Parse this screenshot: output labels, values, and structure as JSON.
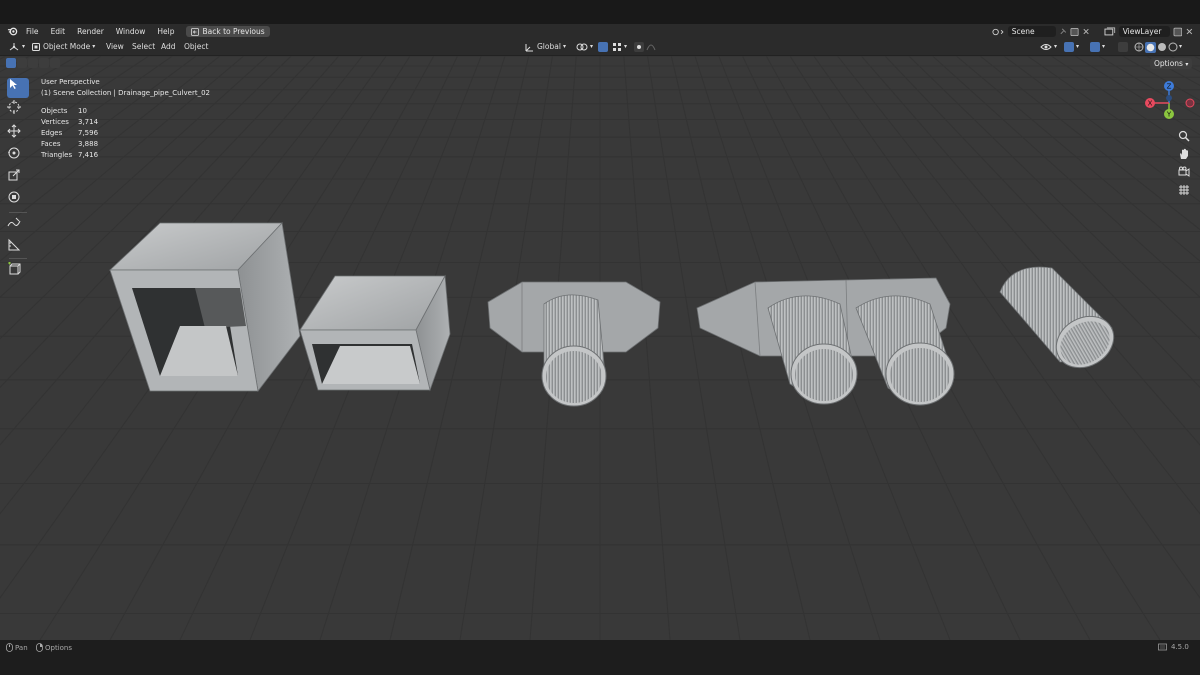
{
  "menubar": {
    "items": [
      "File",
      "Edit",
      "Render",
      "Window",
      "Help"
    ],
    "back_label": "Back to Previous",
    "scene": "Scene",
    "view_layer": "ViewLayer"
  },
  "header": {
    "mode": "Object Mode",
    "menus": [
      "View",
      "Select",
      "Add",
      "Object"
    ],
    "transform_orientation": "Global",
    "options_label": "Options"
  },
  "viewport": {
    "perspective": "User Perspective",
    "collection": "(1) Scene Collection | Drainage_pipe_Culvert_02",
    "stats": [
      {
        "label": "Objects",
        "value": "10"
      },
      {
        "label": "Vertices",
        "value": "3,714"
      },
      {
        "label": "Edges",
        "value": "7,596"
      },
      {
        "label": "Faces",
        "value": "3,888"
      },
      {
        "label": "Triangles",
        "value": "7,416"
      }
    ],
    "gizmo": {
      "x": "X",
      "y": "Y",
      "z": "Z"
    },
    "colors": {
      "x": "#e84a5f",
      "y": "#8cc63f",
      "z": "#3d7bd9",
      "active": "#4772b3"
    }
  },
  "toolbar": {
    "tools": [
      "select-box",
      "cursor",
      "move",
      "rotate",
      "scale",
      "transform",
      "annotate",
      "measure",
      "add-cube"
    ]
  },
  "statusbar": {
    "pan": "Pan",
    "options": "Options",
    "version": "4.5.0"
  }
}
